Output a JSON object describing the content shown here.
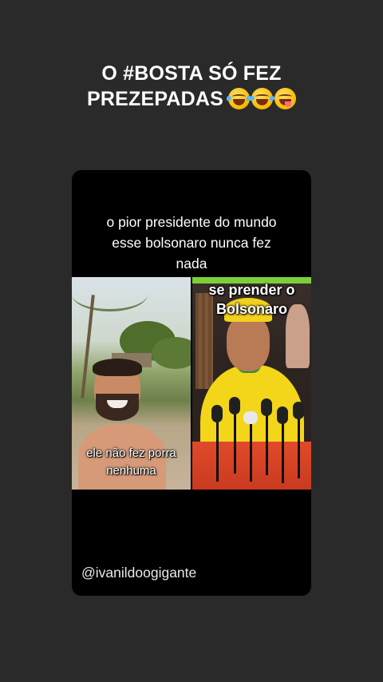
{
  "story": {
    "title_line1": "O #BOSTA SÓ FEZ",
    "title_line2": "PREZEPADAS",
    "title_emojis": [
      "rolling-on-floor-laughing-emoji",
      "rolling-on-floor-laughing-emoji",
      "face-savoring-food-emoji"
    ]
  },
  "post": {
    "caption_lines": [
      "o pior presidente do mundo",
      "esse bolsonaro nunca fez",
      "nada"
    ],
    "meme": {
      "left_text_lines": [
        "ele não fez porra",
        "nenhuma"
      ],
      "right_text_lines": [
        "se prender o",
        "Bolsonaro"
      ]
    },
    "handle": "@ivanildoogigante"
  },
  "colors": {
    "background": "#2b2a2a",
    "card": "#000000",
    "text": "#ffffff"
  }
}
